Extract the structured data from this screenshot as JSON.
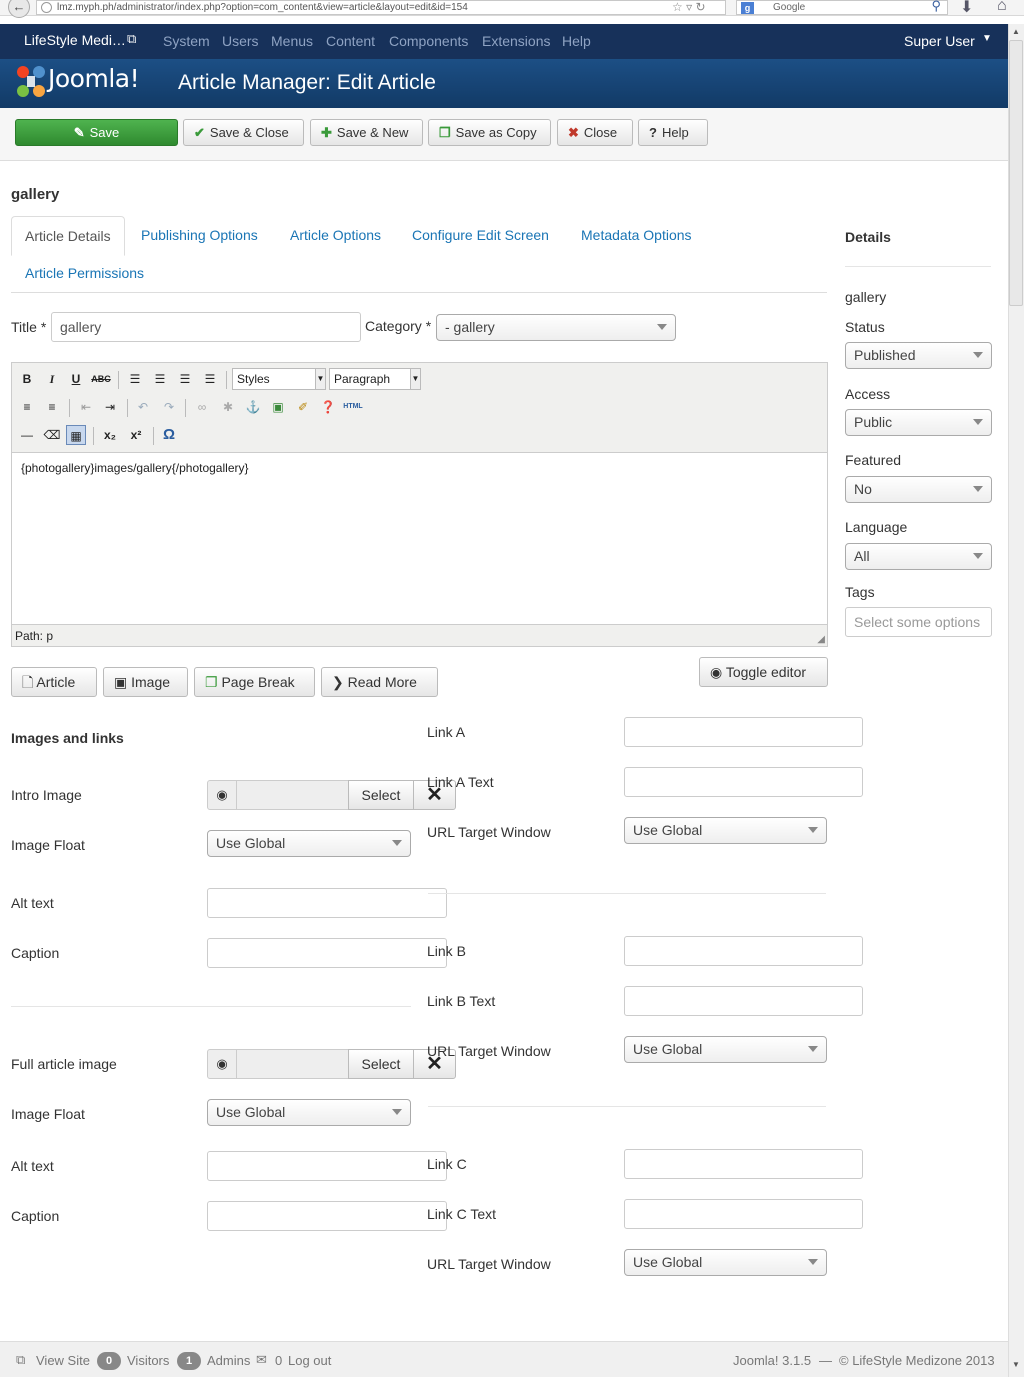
{
  "browser": {
    "url": "lmz.myph.ph/administrator/index.php?option=com_content&view=article&layout=edit&id=154",
    "search_placeholder": "Google"
  },
  "topnav": {
    "site_name": "LifeStyle Medi…",
    "menu": [
      "System",
      "Users",
      "Menus",
      "Content",
      "Components",
      "Extensions",
      "Help"
    ],
    "user": "Super User"
  },
  "header": {
    "logo_text": "Joomla!",
    "title": "Article Manager: Edit Article"
  },
  "toolbar": {
    "save": "Save",
    "save_close": "Save & Close",
    "save_new": "Save & New",
    "save_copy": "Save as Copy",
    "close": "Close",
    "help": "Help"
  },
  "article": {
    "heading": "gallery",
    "tabs": [
      "Article Details",
      "Publishing Options",
      "Article Options",
      "Configure Edit Screen",
      "Metadata Options",
      "Article Permissions"
    ],
    "title_label": "Title *",
    "title_value": "gallery",
    "category_label": "Category *",
    "category_value": "- gallery"
  },
  "editor": {
    "styles": "Styles",
    "format": "Paragraph",
    "content": "{photogallery}images/gallery{/photogallery}",
    "path": "Path: p",
    "html_label": "HTML"
  },
  "editor_buttons": {
    "article": "Article",
    "image": "Image",
    "page_break": "Page Break",
    "read_more": "Read More",
    "toggle": "Toggle editor"
  },
  "images_links": {
    "heading": "Images and links",
    "intro_image": "Intro Image",
    "image_float": "Image Float",
    "alt_text": "Alt text",
    "caption": "Caption",
    "full_image": "Full article image",
    "select": "Select",
    "use_global": "Use Global",
    "link_a": "Link A",
    "link_a_text": "Link A Text",
    "link_b": "Link B",
    "link_b_text": "Link B Text",
    "link_c": "Link C",
    "link_c_text": "Link C Text",
    "url_target": "URL Target Window"
  },
  "sidebar": {
    "heading": "Details",
    "name": "gallery",
    "status_label": "Status",
    "status_value": "Published",
    "access_label": "Access",
    "access_value": "Public",
    "featured_label": "Featured",
    "featured_value": "No",
    "language_label": "Language",
    "language_value": "All",
    "tags_label": "Tags",
    "tags_placeholder": "Select some options"
  },
  "footer": {
    "view_site": "View Site",
    "visitors_count": "0",
    "visitors": "Visitors",
    "admins_count": "1",
    "admins": "Admins",
    "messages_count": "0",
    "logout": "Log out",
    "version": "Joomla! 3.1.5",
    "copyright": "© LifeStyle Medizone 2013"
  }
}
